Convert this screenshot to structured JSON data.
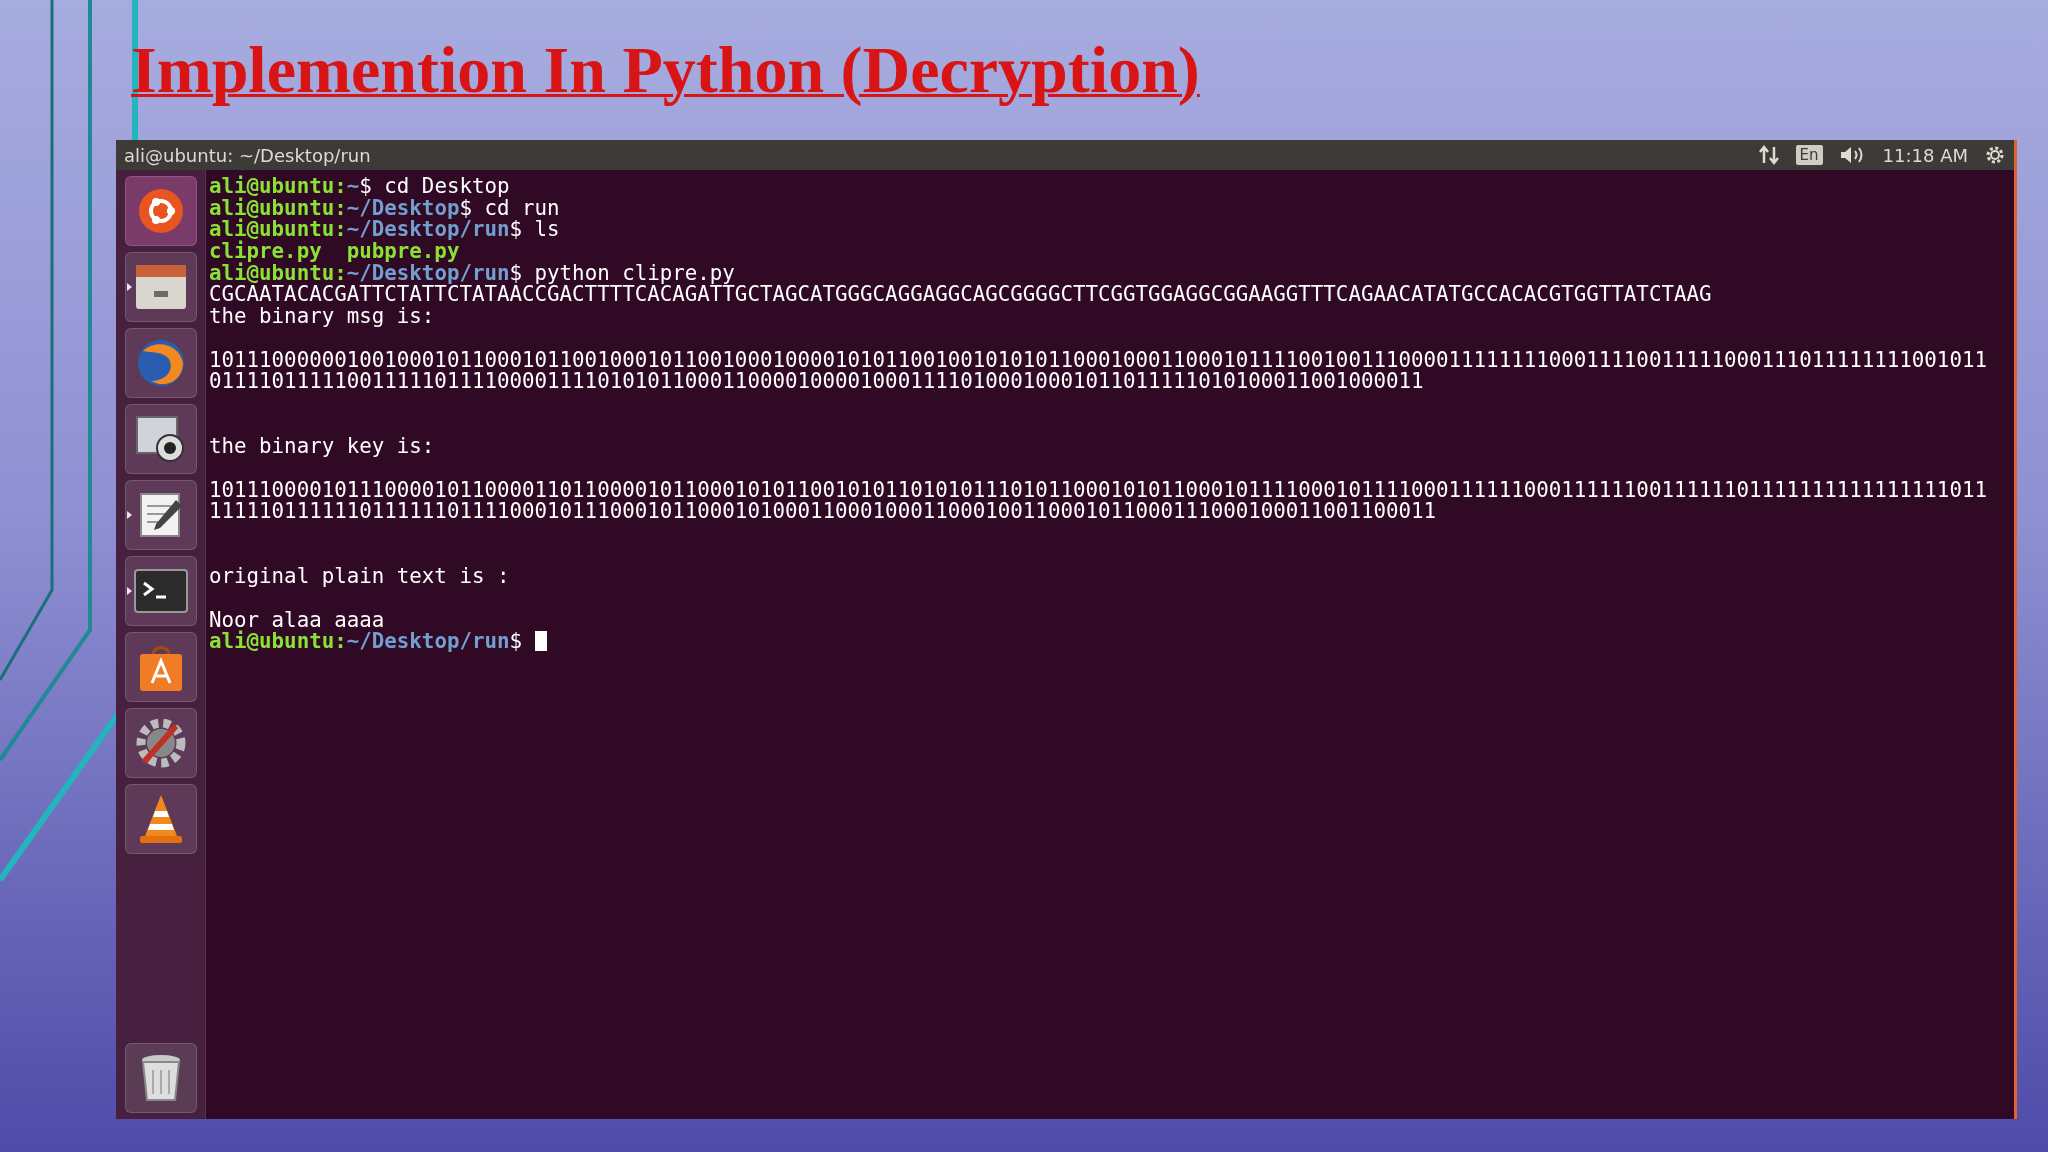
{
  "slide": {
    "title": "Implemention In Python (Decryption)"
  },
  "window": {
    "title": "ali@ubuntu: ~/Desktop/run"
  },
  "top_bar": {
    "keyboard": "En",
    "clock": "11:18 AM"
  },
  "dock": [
    {
      "kind": "ubuntu",
      "running": false
    },
    {
      "kind": "files",
      "running": true
    },
    {
      "kind": "browser",
      "running": false
    },
    {
      "kind": "camera",
      "running": false
    },
    {
      "kind": "editor",
      "running": true
    },
    {
      "kind": "terminal",
      "running": true
    },
    {
      "kind": "store",
      "running": false
    },
    {
      "kind": "settings",
      "running": false
    },
    {
      "kind": "player",
      "running": false
    },
    {
      "kind": "trash",
      "running": false
    }
  ],
  "terminal": [
    {
      "kind": "prompt",
      "user": "ali@ubuntu:",
      "path": "~",
      "command": "$ cd Desktop",
      "cursor": false
    },
    {
      "kind": "prompt",
      "user": "ali@ubuntu:",
      "path": "~/Desktop",
      "command": "$ cd run",
      "cursor": false
    },
    {
      "kind": "prompt",
      "user": "ali@ubuntu:",
      "path": "~/Desktop/run",
      "command": "$ ls",
      "cursor": false
    },
    {
      "kind": "listing",
      "text": "clipre.py  pubpre.py"
    },
    {
      "kind": "prompt",
      "user": "ali@ubuntu:",
      "path": "~/Desktop/run",
      "command": "$ python clipre.py",
      "cursor": false
    },
    {
      "kind": "output",
      "text": "CGCAATACACGATTCTATTCTATAACCGACTTTTCACAGATTGCTAGCATGGGCAGGAGGCAGCGGGGCTTCGGTGGAGGCGGAAGGTTTCAGAACATATGCCACACGTGGTTATCTAAG"
    },
    {
      "kind": "output",
      "text": "the binary msg is:"
    },
    {
      "kind": "blank"
    },
    {
      "kind": "output",
      "text": "1011100000010010001011000101100100010110010001000010101100100101010110001000110001011110010011100001111111100011110011111000111011111111001011"
    },
    {
      "kind": "output",
      "text": "0111101111100111110111100001111010101100011000010000100011110100010001011011111010100011001000011"
    },
    {
      "kind": "blank"
    },
    {
      "kind": "blank"
    },
    {
      "kind": "output",
      "text": "the binary key is:"
    },
    {
      "kind": "blank"
    },
    {
      "kind": "output",
      "text": "1011100001011100001011000011011000010110001010110010101101010111010110001010110001011110001011110001111110001111110011111101111111111111111011"
    },
    {
      "kind": "output",
      "text": "11111011111101111110111100010111000101100010100011000100011000100110001011000111000100011001100011"
    },
    {
      "kind": "blank"
    },
    {
      "kind": "blank"
    },
    {
      "kind": "output",
      "text": "original plain text is :"
    },
    {
      "kind": "blank"
    },
    {
      "kind": "output",
      "text": "Noor alaa aaaa"
    },
    {
      "kind": "prompt",
      "user": "ali@ubuntu:",
      "path": "~/Desktop/run",
      "command": "$ ",
      "cursor": true
    }
  ]
}
